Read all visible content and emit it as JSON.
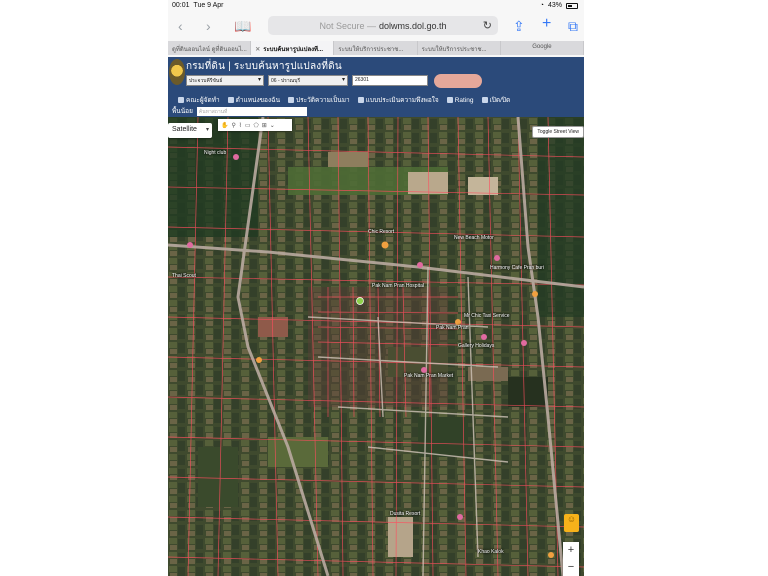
{
  "status": {
    "time": "00:01",
    "date": "Tue 9 Apr",
    "battery": "43%",
    "wifi_icon": "wifi-icon"
  },
  "browser": {
    "url_prefix": "Not Secure —",
    "url": "dolwms.dol.go.th",
    "tabs": [
      {
        "label": "ดูที่ดินออนไลน์ ดูที่ดินออนไ...",
        "active": false
      },
      {
        "label": "ระบบค้นหารูปแปลงที...",
        "active": true
      },
      {
        "label": "ระบบให้บริการประชาช...",
        "active": false
      },
      {
        "label": "ระบบให้บริการประชาช...",
        "active": false
      },
      {
        "label": "Google",
        "active": false
      }
    ]
  },
  "dol": {
    "title": "กรมที่ดิน | ระบบค้นหารูปแปลงที่ดิน",
    "province": "ประจวบคีรีขันธ์",
    "district": "06 - ปราณบุรี",
    "parcel": "26301",
    "menu": [
      "คณะผู้จัดทำ",
      "ตำแหน่งของฉัน",
      "ประวัติความเป็นมา",
      "แบบประเมินความพึงพอใจ",
      "Rating",
      "เปิด/ปิด"
    ],
    "menu_row2_label": "พื้นน้อย",
    "search_placeholder": "ค้นหาสถานที่"
  },
  "map": {
    "type_label": "Satellite",
    "toggle_street_view": "Toggle Street View",
    "zoom_in": "+",
    "zoom_out": "−",
    "pois": [
      "Night club",
      "Chic Resort",
      "New Beach Motor",
      "Thai Scout",
      "Harmony Cafe Pran buri",
      "Pak Nam Pran Hospital",
      "Mr Chic Taxi Service",
      "Pak Nam Pran",
      "Gallery Holidays",
      "Pak Nam Pran Market",
      "Dusita Resort",
      "Khao Kalok"
    ]
  },
  "colors": {
    "header_bg": "#2b4a7a",
    "parcel_line": "#ff4d5e",
    "accent_blue": "#3478f6"
  }
}
